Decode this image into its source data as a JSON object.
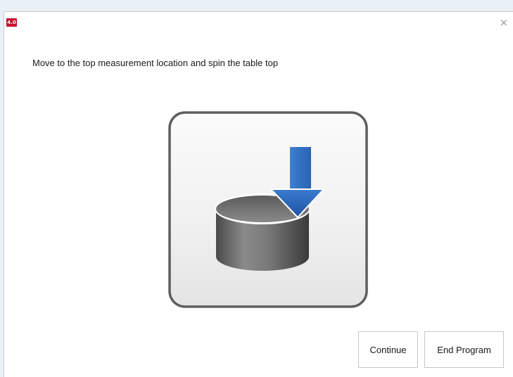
{
  "window": {
    "app_icon_text": "4.0",
    "close_glyph": "×"
  },
  "main": {
    "instruction": "Move to the top measurement location and spin the table top",
    "illustration_icon": "cylinder-with-down-arrow-icon"
  },
  "buttons": {
    "continue_label": "Continue",
    "end_program_label": "End Program"
  },
  "colors": {
    "app_icon_red": "#c8102e",
    "arrow_blue": "#2f6fc0",
    "cylinder_gray": "#6a6a6a",
    "frame_border": "#5e5e5e"
  }
}
